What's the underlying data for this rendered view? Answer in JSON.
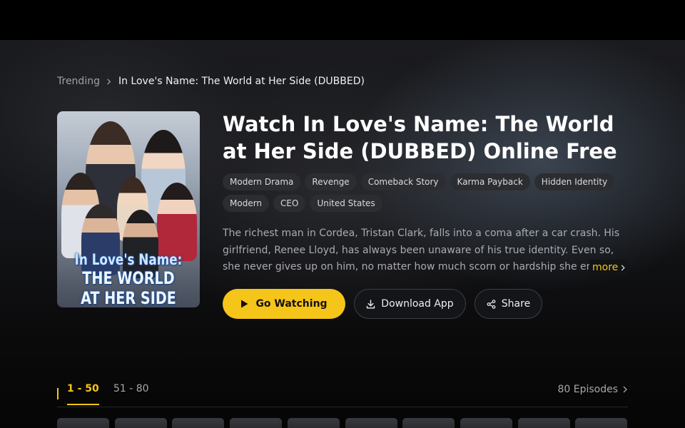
{
  "breadcrumb": {
    "root": "Trending",
    "current": "In Love's Name: The World at Her Side (DUBBED)"
  },
  "poster": {
    "line1": "In Love's Name:",
    "line2": "THE WORLD AT HER SIDE"
  },
  "title": "Watch In Love's Name: The World at Her Side (DUBBED) Online Free",
  "tags": [
    "Modern Drama",
    "Revenge",
    "Comeback Story",
    "Karma Payback",
    "Hidden Identity",
    "Modern",
    "CEO",
    "United States"
  ],
  "description": "The richest man in Cordea, Tristan Clark, falls into a coma after a car crash. His girlfriend, Renee Lloyd, has always been unaware of his true identity. Even so, she never gives up on him, no matter how much scorn or hardship she endures.",
  "more_label": "more",
  "actions": {
    "watch": "Go Watching",
    "download": "Download App",
    "share": "Share"
  },
  "episodes": {
    "tabs": [
      "1 - 50",
      "51 - 80"
    ],
    "active_tab": 0,
    "count": "80 Episodes",
    "visible_thumbnails": 10
  },
  "colors": {
    "accent": "#f6c519",
    "background": "#000000",
    "tag_bg": "#2c2d31"
  },
  "icons": {
    "breadcrumb_separator": "chevron-right-icon",
    "watch": "play-icon",
    "download": "download-icon",
    "share": "share-icon",
    "episodes": "chevron-right-icon"
  }
}
